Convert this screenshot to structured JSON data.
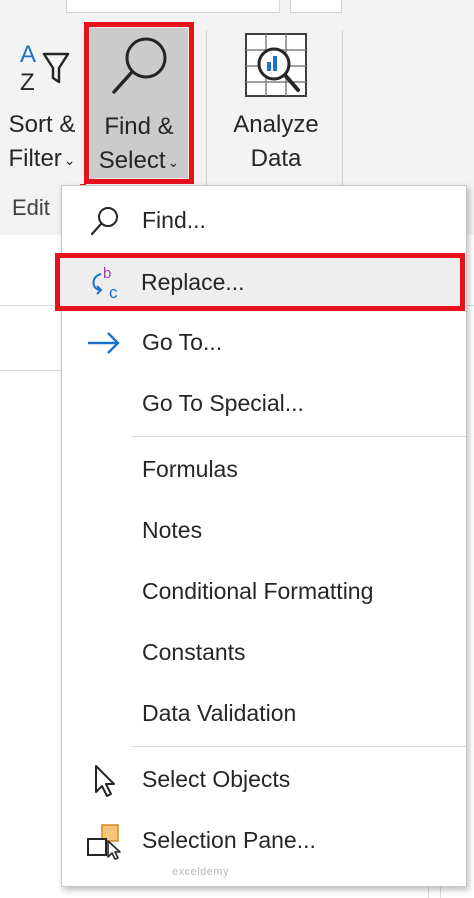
{
  "ribbon": {
    "sort_filter": {
      "line1": "Sort &",
      "line2": "Filter",
      "icon": "sort-az-filter-icon"
    },
    "find_select": {
      "line1": "Find &",
      "line2": "Select",
      "icon": "magnifier-icon"
    },
    "analyze_data": {
      "line1": "Analyze",
      "line2": "Data",
      "icon": "analyze-data-icon"
    },
    "group_label": "Edit"
  },
  "menu": {
    "items": [
      {
        "label": "Find...",
        "icon": "find-magnifier-icon"
      },
      {
        "label": "Replace...",
        "icon": "replace-icon"
      },
      {
        "label": "Go To...",
        "icon": "arrow-right-icon"
      },
      {
        "label": "Go To Special..."
      },
      {
        "label": "Formulas"
      },
      {
        "label": "Notes"
      },
      {
        "label": "Conditional Formatting"
      },
      {
        "label": "Constants"
      },
      {
        "label": "Data Validation"
      },
      {
        "label": "Select Objects",
        "icon": "cursor-pointer-icon"
      },
      {
        "label": "Selection Pane...",
        "icon": "selection-pane-icon"
      }
    ]
  },
  "watermark": "exceldemy",
  "colors": {
    "highlight": "#e8101a",
    "accent_blue": "#1a73c7",
    "replace_purple": "#a040c0"
  }
}
